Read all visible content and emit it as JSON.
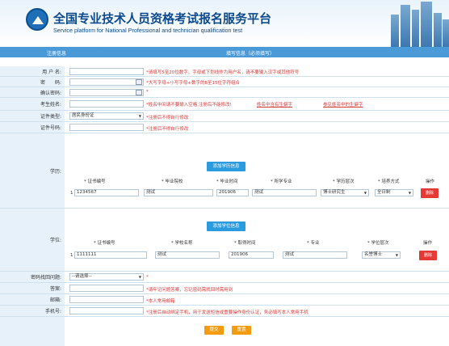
{
  "banner": {
    "title_cn": "全国专业技术人员资格考试报名服务平台",
    "title_en": "Service platform for National Professional and technician qualification test"
  },
  "header": {
    "left": "注册信息",
    "right": "填写信息（必须填写）"
  },
  "fields": {
    "username": {
      "label": "用 户 名:",
      "value": "",
      "hint": "*请填写5至20位数字、字母或下划线作为用户名，请不要输入汉字或其他符号"
    },
    "password": {
      "label": "密　　码:",
      "value": "",
      "hint": "*大写字母+小写字母+数字的8至15位字符组合"
    },
    "confirm": {
      "label": "确认密码:",
      "value": "",
      "hint": "*"
    },
    "name": {
      "label": "考生姓名:",
      "value": "",
      "hint": "*姓名中间请不要输入空格,注册后不能修改!",
      "link1": "姓名中含有生僻字",
      "link2": "参见姓名中的生僻字"
    },
    "id_type": {
      "label": "证件类型:",
      "value": "居民身份证",
      "hint": "*注册后不得自行修改"
    },
    "id_no": {
      "label": "证件号码:",
      "value": "",
      "hint": "*注册后不得自行修改"
    },
    "question": {
      "label": "密码找回问题:",
      "value": "--请选择--",
      "hint": "*"
    },
    "answer": {
      "label": "答案:",
      "value": "",
      "hint": "*请牢记问题答案，忘记密码需找回时需用到"
    },
    "email": {
      "label": "邮箱:",
      "value": "",
      "hint": "*本人常用邮箱"
    },
    "phone": {
      "label": "手机号:",
      "value": "",
      "hint": "*注册后自动绑定手机，用于发送短信或重要操作身份认证，务必填写本人常用手机"
    }
  },
  "education": {
    "label": "学历:",
    "add_button": "添加学历信息",
    "cols": [
      "* 证书编号",
      "* 毕业院校",
      "* 毕业时间",
      "* 所学专业",
      "* 学历层次",
      "* 培养方式",
      "操作"
    ],
    "row": {
      "index": "1",
      "cert": "1234567",
      "school": "测试",
      "time": "201906",
      "major": "测试",
      "level": "博士研究生",
      "mode": "全日制",
      "del": "删除"
    }
  },
  "degree": {
    "label": "学位:",
    "add_button": "添加学位信息",
    "cols": [
      "* 证书编号",
      "* 学校名称",
      "* 取得时间",
      "* 专业",
      "* 学位层次",
      "操作"
    ],
    "row": {
      "index": "1",
      "cert": "1111111",
      "school": "测试",
      "time": "201906",
      "major": "测试",
      "level": "名誉博士",
      "del": "删除"
    }
  },
  "footer": {
    "submit": "提交",
    "reset": "重置"
  }
}
